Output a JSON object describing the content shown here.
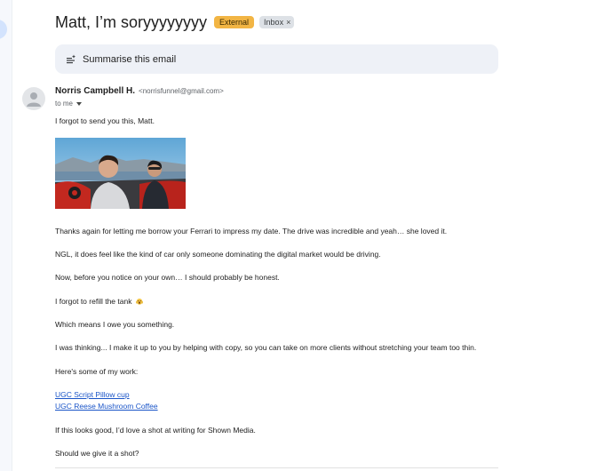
{
  "email": {
    "subject": "Matt, I’m soryyyyyyyy",
    "labels": {
      "external": "External",
      "inbox": "Inbox",
      "inbox_remove": "×"
    },
    "summarise_label": "Summarise this email",
    "sender": {
      "name": "Norris Campbell H.",
      "email": "<norrisfunnel@gmail.com>"
    },
    "to_label": "to me",
    "body": {
      "greeting": "I forgot to send you this, Matt.",
      "p1": "Thanks again for letting me borrow your Ferrari to impress my date. The drive was incredible and yeah… she loved it.",
      "p2": "NGL, it does feel like the kind of car only someone dominating the digital market would be driving.",
      "p3": "Now, before you notice on your own… I should probably be honest.",
      "p4": "I forgot to refill the tank",
      "p4_emoji": "scream-emoji",
      "p5": "Which means I owe you something.",
      "p6": "I was thinking... I make it up to you by helping with copy, so you can take on more clients without stretching your team too thin.",
      "p7": "Here's some of my work:",
      "links": [
        "UGC Script Pillow cup",
        "UGC Reese Mushroom Coffee"
      ],
      "p8": "If this looks good, I’d love a shot at writing for Shown Media.",
      "p9": "Should we give it a shot?"
    }
  },
  "colors": {
    "external_badge": "#f2b544",
    "inbox_badge": "#dde1e6",
    "summarise_bg": "#eef1f7",
    "link": "#1a55c8"
  }
}
